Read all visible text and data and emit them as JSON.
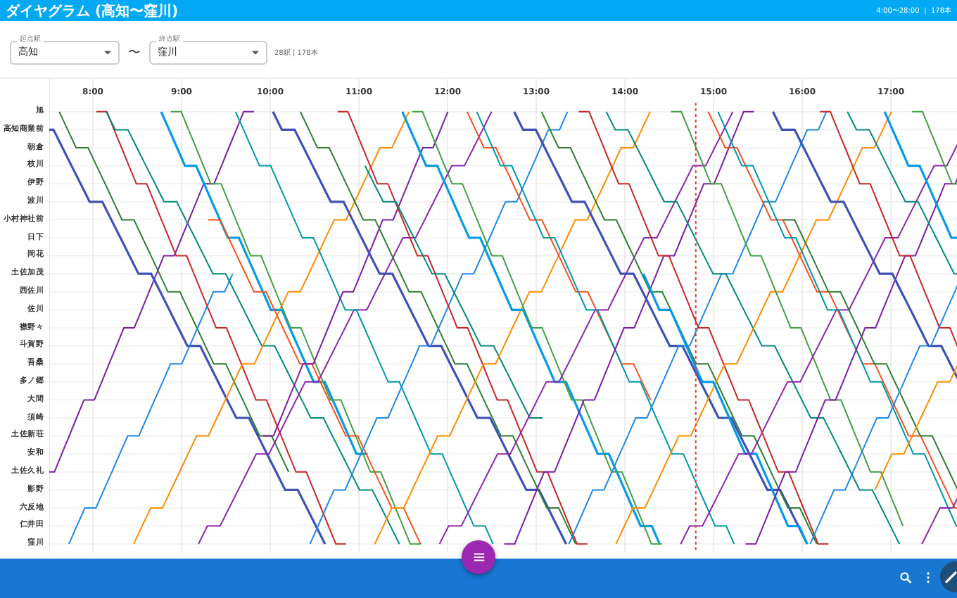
{
  "header": {
    "title": "ダイヤグラム (高知〜窪川)",
    "range": "4:00〜28:00 ｜ 178本"
  },
  "controls": {
    "start_station": {
      "label": "起点駅",
      "value": "高知"
    },
    "separator": "〜",
    "end_station": {
      "label": "終点駅",
      "value": "窪川"
    },
    "summary": "28駅 | 178本"
  },
  "chart": {
    "hours": [
      "8:00",
      "9:00",
      "10:00",
      "11:00",
      "12:00",
      "13:00",
      "14:00",
      "15:00",
      "16:00",
      "17:00"
    ],
    "stations": [
      "旭",
      "高知商業前",
      "朝倉",
      "枝川",
      "伊野",
      "波川",
      "小村神社前",
      "日下",
      "岡花",
      "土佐加茂",
      "西佐川",
      "佐川",
      "襟野々",
      "斗賀野",
      "吾桑",
      "多ノ郷",
      "大間",
      "須崎",
      "土佐新荘",
      "安和",
      "土佐久礼",
      "影野",
      "六反地",
      "仁井田",
      "窪川"
    ]
  }
}
